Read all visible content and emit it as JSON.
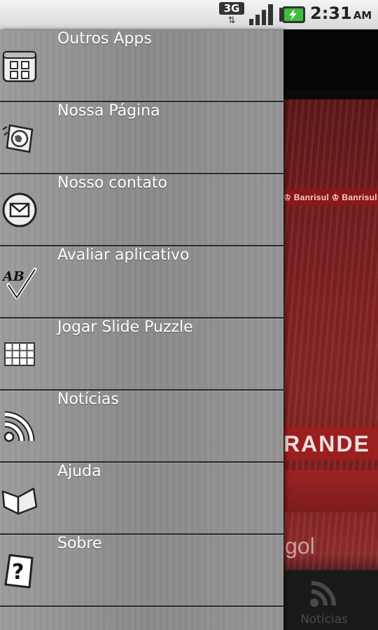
{
  "status_bar": {
    "network": "3G",
    "network_arrows": "⇅",
    "time": "2:31",
    "ampm": "AM"
  },
  "menu": {
    "items": [
      {
        "label": "Outros Apps",
        "icon": "apps-grid-icon"
      },
      {
        "label": "Nossa Página",
        "icon": "globe-page-icon"
      },
      {
        "label": "Nosso contato",
        "icon": "envelope-icon"
      },
      {
        "label": "Avaliar aplicativo",
        "icon": "ab-check-icon"
      },
      {
        "label": "Jogar Slide Puzzle",
        "icon": "puzzle-grid-icon"
      },
      {
        "label": "Notícias",
        "icon": "rss-icon"
      },
      {
        "label": "Ajuda",
        "icon": "book-icon"
      },
      {
        "label": "Sobre",
        "icon": "question-card-icon"
      }
    ]
  },
  "background_app": {
    "ad_text": "♔ Banrisul ♔ Banrisul",
    "banner_text": "RANDE",
    "overlay_text": "gol",
    "bottom_tab_label": "Notícias"
  }
}
